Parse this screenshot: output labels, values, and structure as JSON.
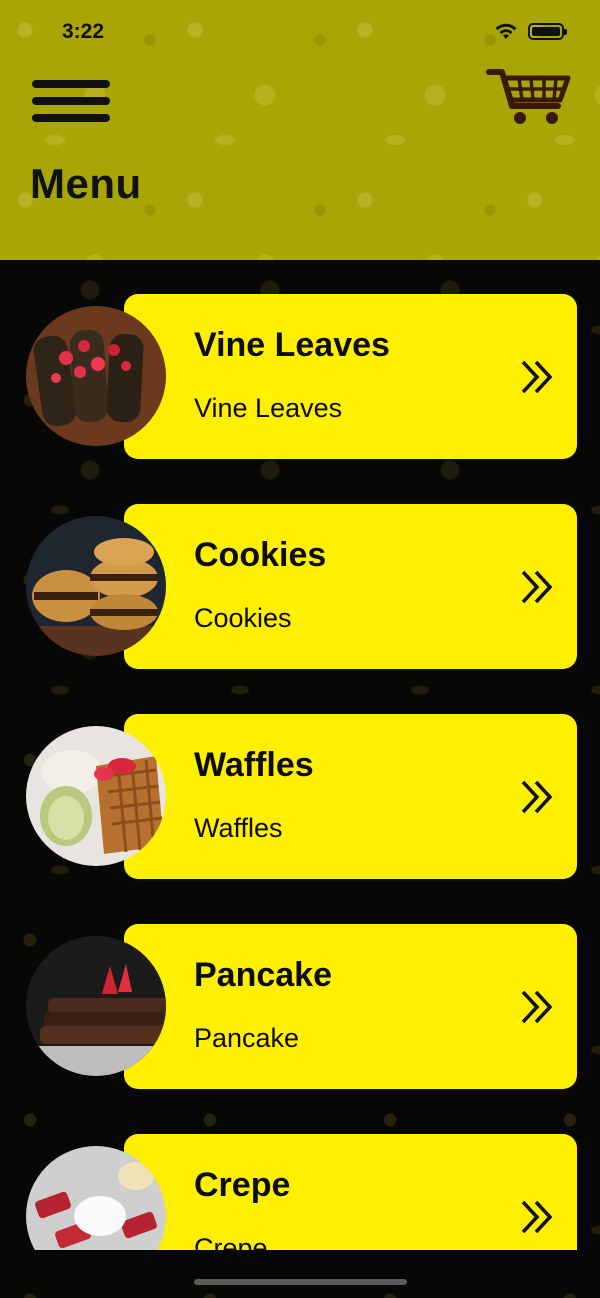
{
  "status_bar": {
    "time": "3:22",
    "icons": [
      "wifi-icon",
      "battery-icon"
    ]
  },
  "header": {
    "title": "Menu",
    "menu_icon": "hamburger-menu-icon",
    "cart_icon": "shopping-cart-icon",
    "background_color": "#a8a506"
  },
  "menu": {
    "card_color": "#fff000",
    "items": [
      {
        "title": "Vine Leaves",
        "subtitle": "Vine Leaves",
        "image": "vine-leaves-photo"
      },
      {
        "title": "Cookies",
        "subtitle": "Cookies",
        "image": "cookies-photo"
      },
      {
        "title": "Waffles",
        "subtitle": "Waffles",
        "image": "waffles-photo"
      },
      {
        "title": "Pancake",
        "subtitle": "Pancake",
        "image": "pancake-photo"
      },
      {
        "title": "Crepe",
        "subtitle": "Crepe",
        "image": "crepe-photo"
      }
    ]
  }
}
